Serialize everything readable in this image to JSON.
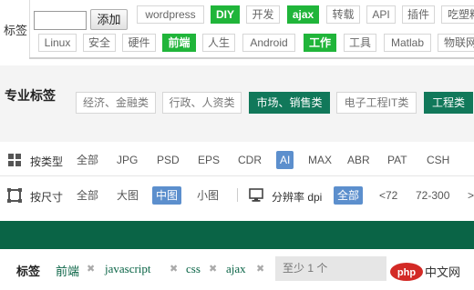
{
  "tag_editor": {
    "label": "标签",
    "add_label": "添加",
    "row1": [
      {
        "text": "wordpress",
        "active": false
      },
      {
        "text": "DIY",
        "active": true
      },
      {
        "text": "开发",
        "active": false
      },
      {
        "text": "ajax",
        "active": true
      },
      {
        "text": "转载",
        "active": false
      },
      {
        "text": "API",
        "active": false
      },
      {
        "text": "插件",
        "active": false
      },
      {
        "text": "吃塑料",
        "active": false
      }
    ],
    "row2": [
      {
        "text": "Linux",
        "active": false
      },
      {
        "text": "安全",
        "active": false
      },
      {
        "text": "硬件",
        "active": false
      },
      {
        "text": "前端",
        "active": true
      },
      {
        "text": "人生",
        "active": false
      },
      {
        "text": "Android",
        "active": false
      },
      {
        "text": "工作",
        "active": true
      },
      {
        "text": "工具",
        "active": false
      },
      {
        "text": "Matlab",
        "active": false
      },
      {
        "text": "物联网",
        "active": false
      }
    ]
  },
  "pro_tags": {
    "label": "专业标签",
    "items": [
      {
        "text": "经济、金融类",
        "active": false
      },
      {
        "text": "行政、人资类",
        "active": false
      },
      {
        "text": "市场、销售类",
        "active": true
      },
      {
        "text": "电子工程IT类",
        "active": false
      },
      {
        "text": "工程类",
        "active": true
      }
    ]
  },
  "filters": {
    "type_label": "按类型",
    "type_options": [
      {
        "text": "全部",
        "active": false
      },
      {
        "text": "JPG",
        "active": false
      },
      {
        "text": "PSD",
        "active": false
      },
      {
        "text": "EPS",
        "active": false
      },
      {
        "text": "CDR",
        "active": false
      },
      {
        "text": "AI",
        "active": true
      },
      {
        "text": "MAX",
        "active": false
      },
      {
        "text": "ABR",
        "active": false
      },
      {
        "text": "PAT",
        "active": false
      },
      {
        "text": "CSH",
        "active": false
      }
    ],
    "size_label": "按尺寸",
    "size_options": [
      {
        "text": "全部",
        "active": false
      },
      {
        "text": "大图",
        "active": false
      },
      {
        "text": "中图",
        "active": true
      },
      {
        "text": "小图",
        "active": false
      }
    ],
    "res_label": "分辨率 dpi",
    "res_options": [
      {
        "text": "全部",
        "active": true
      },
      {
        "text": "<72",
        "active": false
      },
      {
        "text": "72-300",
        "active": false
      },
      {
        "text": ">",
        "active": false
      }
    ]
  },
  "tag_chips": {
    "label": "标签",
    "chips": [
      "前端",
      "javascript",
      "css",
      "ajax"
    ],
    "remove_glyph": "✖",
    "input_placeholder": "至少 1 个"
  },
  "watermark": {
    "text": "php中文网",
    "logo": "php"
  },
  "colors": {
    "green": "#20b53a",
    "dark_green": "#0a6446",
    "teal": "#11785a",
    "blue": "#5c8fcd"
  }
}
